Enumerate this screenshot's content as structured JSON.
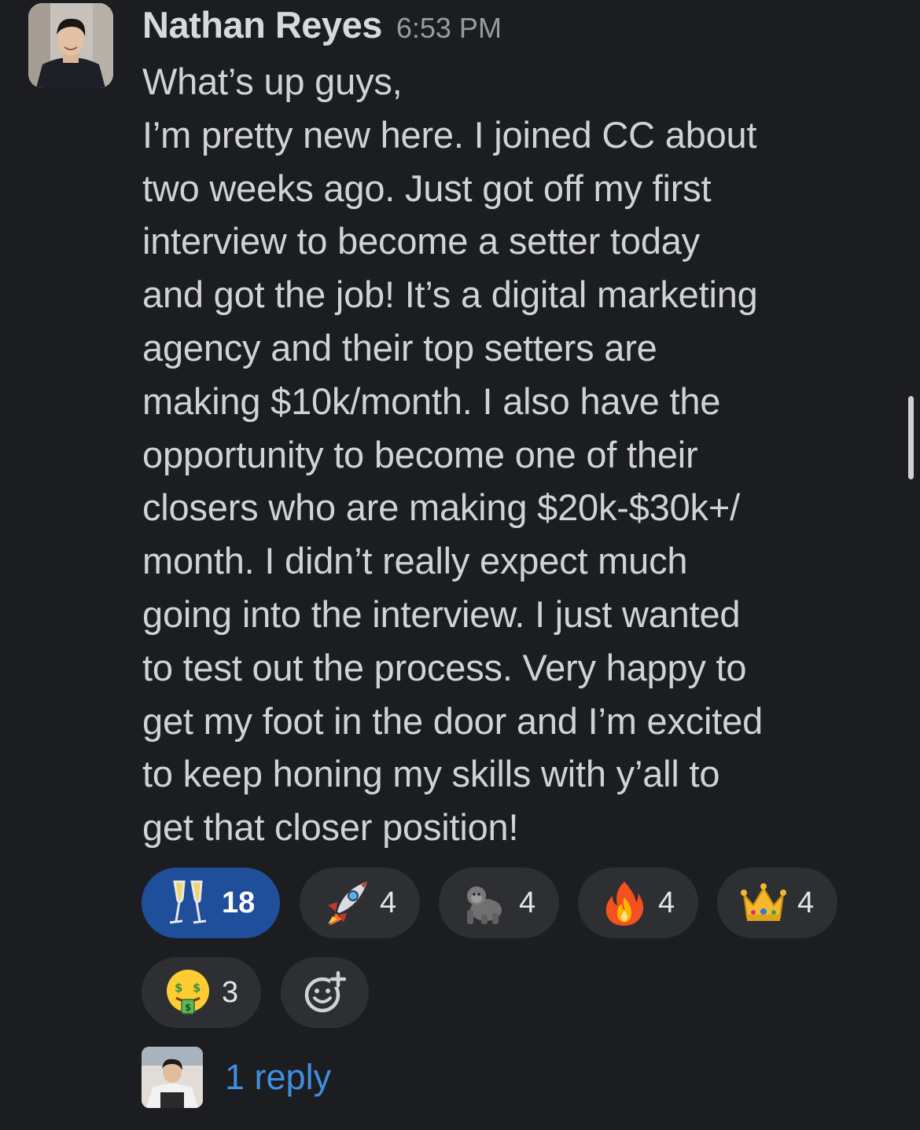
{
  "message": {
    "author": "Nathan Reyes",
    "time": "6:53 PM",
    "lines": [
      "What’s up guys,",
      "I’m pretty new here. I joined CC about",
      "two weeks ago. Just got off my first",
      "interview to become a setter today",
      "and got the job! It’s a digital marketing",
      "agency and their top setters are",
      "making $10k/month. I also have the",
      "opportunity to become one of their",
      "closers who are making $20k-$30k+/",
      "month. I didn’t really expect much",
      "going into the interview. I just wanted",
      "to test out the process. Very happy to",
      "get my foot in the door and I’m excited",
      "to keep honing my skills with y’all to",
      "get that closer position!"
    ]
  },
  "reactions": [
    {
      "emoji": "clinking-glasses-icon",
      "count": "18",
      "active": true
    },
    {
      "emoji": "rocket-icon",
      "count": "4",
      "active": false
    },
    {
      "emoji": "gorilla-icon",
      "count": "4",
      "active": false
    },
    {
      "emoji": "fire-icon",
      "count": "4",
      "active": false
    },
    {
      "emoji": "crown-icon",
      "count": "4",
      "active": false
    },
    {
      "emoji": "money-mouth-face-icon",
      "count": "3",
      "active": false
    }
  ],
  "add_reaction_icon": "add-reaction-icon",
  "thread": {
    "reply_text": "1 reply"
  },
  "colors": {
    "background": "#1b1d21",
    "active_reaction": "#1f4e9a",
    "reaction_pill": "#2d2f33",
    "link": "#3f8fe0"
  }
}
